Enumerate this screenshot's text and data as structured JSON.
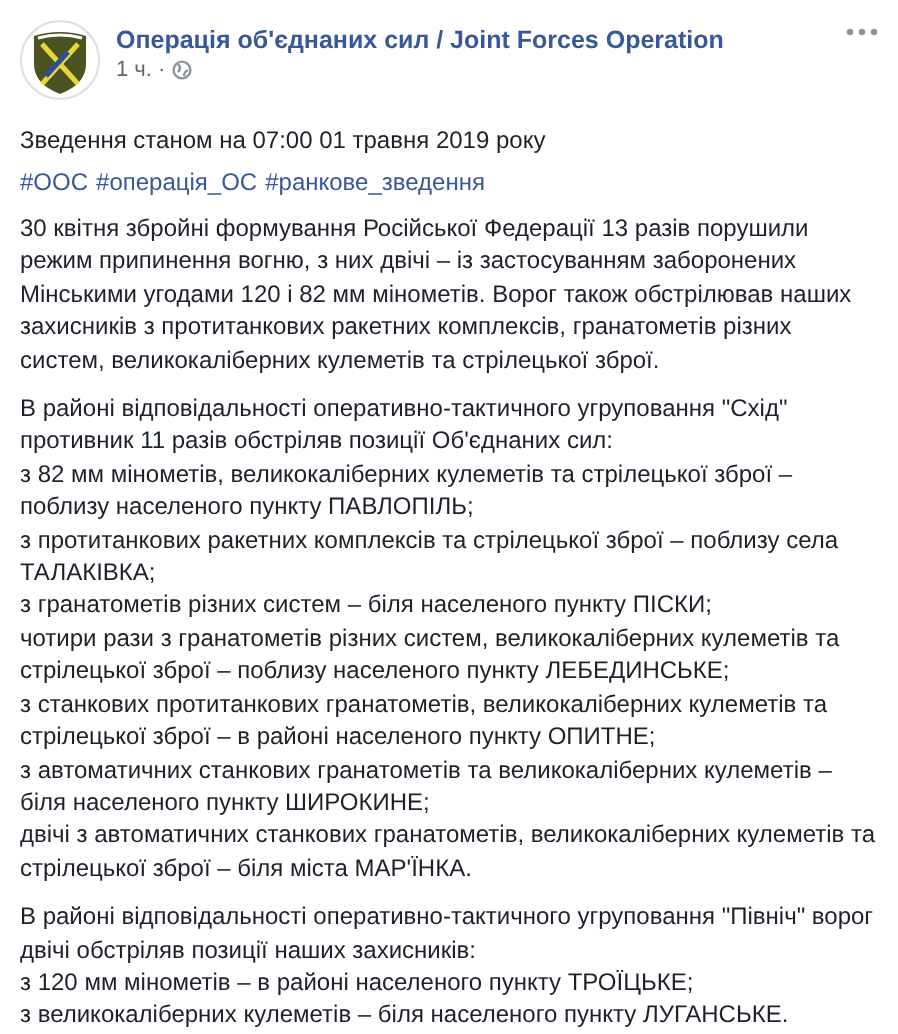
{
  "post": {
    "author": "Операція об'єднаних сил / Joint Forces Operation",
    "time": "1 ч.",
    "separator": "·",
    "title": "Зведення станом на 07:00 01 травня 2019 року",
    "hashtags": [
      "#ООС",
      "#операція_ОС",
      "#ранкове_зведення"
    ],
    "paragraphs": [
      [
        "30 квітня збройні формування Російської Федерації 13 разів порушили режим припинення вогню, з них двічі – із застосуванням заборонених Мінськими угодами 120 і 82 мм мінометів. Ворог також обстрілював наших захисників з протитанкових ракетних комплексів, гранатометів різних систем, великокаліберних кулеметів та стрілецької зброї."
      ],
      [
        "В районі відповідальності оперативно-тактичного угруповання \"Схід\" противник 11 разів обстріляв позиції Об'єднаних сил:",
        "з 82 мм мінометів, великокаліберних кулеметів та стрілецької зброї – поблизу населеного пункту ПАВЛОПІЛЬ;",
        "з протитанкових ракетних комплексів та стрілецької зброї – поблизу села ТАЛАКІВКА;",
        "з гранатометів різних систем – біля населеного пункту ПІСКИ;",
        "чотири рази з гранатометів різних систем, великокаліберних кулеметів та стрілецької зброї – поблизу населеного пункту ЛЕБЕДИНСЬКЕ;",
        "з станкових протитанкових гранатометів, великокаліберних кулеметів та стрілецької зброї – в районі населеного пункту ОПИТНЕ;",
        "з автоматичних станкових гранатометів та великокаліберних кулеметів – біля населеного пункту ШИРОКИНЕ;",
        "двічі з автоматичних станкових гранатометів, великокаліберних кулеметів та стрілецької зброї – біля міста МАР'ЇНКА."
      ],
      [
        "В районі відповідальності оперативно-тактичного угруповання \"Північ\" ворог двічі обстріляв позиції наших захисників:",
        "з 120 мм мінометів – в районі населеного пункту ТРОЇЦЬКЕ;",
        "з великокаліберних кулеметів – біля населеного пункту ЛУГАНСЬКЕ."
      ]
    ]
  }
}
